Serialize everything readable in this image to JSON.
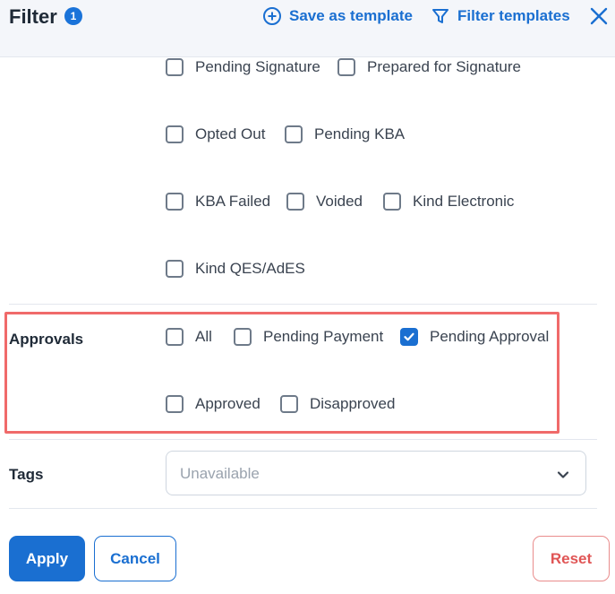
{
  "header": {
    "title": "Filter",
    "active_count": "1",
    "save_template_label": "Save as template",
    "filter_templates_label": "Filter templates"
  },
  "status_options": [
    {
      "label": "Pending Signature",
      "checked": false
    },
    {
      "label": "Prepared for Signature",
      "checked": false
    },
    {
      "label": "Opted Out",
      "checked": false
    },
    {
      "label": "Pending KBA",
      "checked": false
    },
    {
      "label": "KBA Failed",
      "checked": false
    },
    {
      "label": "Voided",
      "checked": false
    },
    {
      "label": "Kind Electronic",
      "checked": false
    },
    {
      "label": "Kind QES/AdES",
      "checked": false
    }
  ],
  "approvals": {
    "label": "Approvals",
    "options": [
      {
        "label": "All",
        "checked": false
      },
      {
        "label": "Pending Payment",
        "checked": false
      },
      {
        "label": "Pending Approval",
        "checked": true
      },
      {
        "label": "Approved",
        "checked": false
      },
      {
        "label": "Disapproved",
        "checked": false
      }
    ]
  },
  "tags": {
    "label": "Tags",
    "placeholder": "Unavailable"
  },
  "footer": {
    "apply_label": "Apply",
    "cancel_label": "Cancel",
    "reset_label": "Reset"
  },
  "colors": {
    "accent": "#1a6fd1",
    "highlight": "#f06a6a",
    "reset": "#e05555"
  },
  "icons": [
    "plus-circle-icon",
    "funnel-icon",
    "close-icon",
    "checkmark-icon",
    "chevron-down-icon"
  ]
}
